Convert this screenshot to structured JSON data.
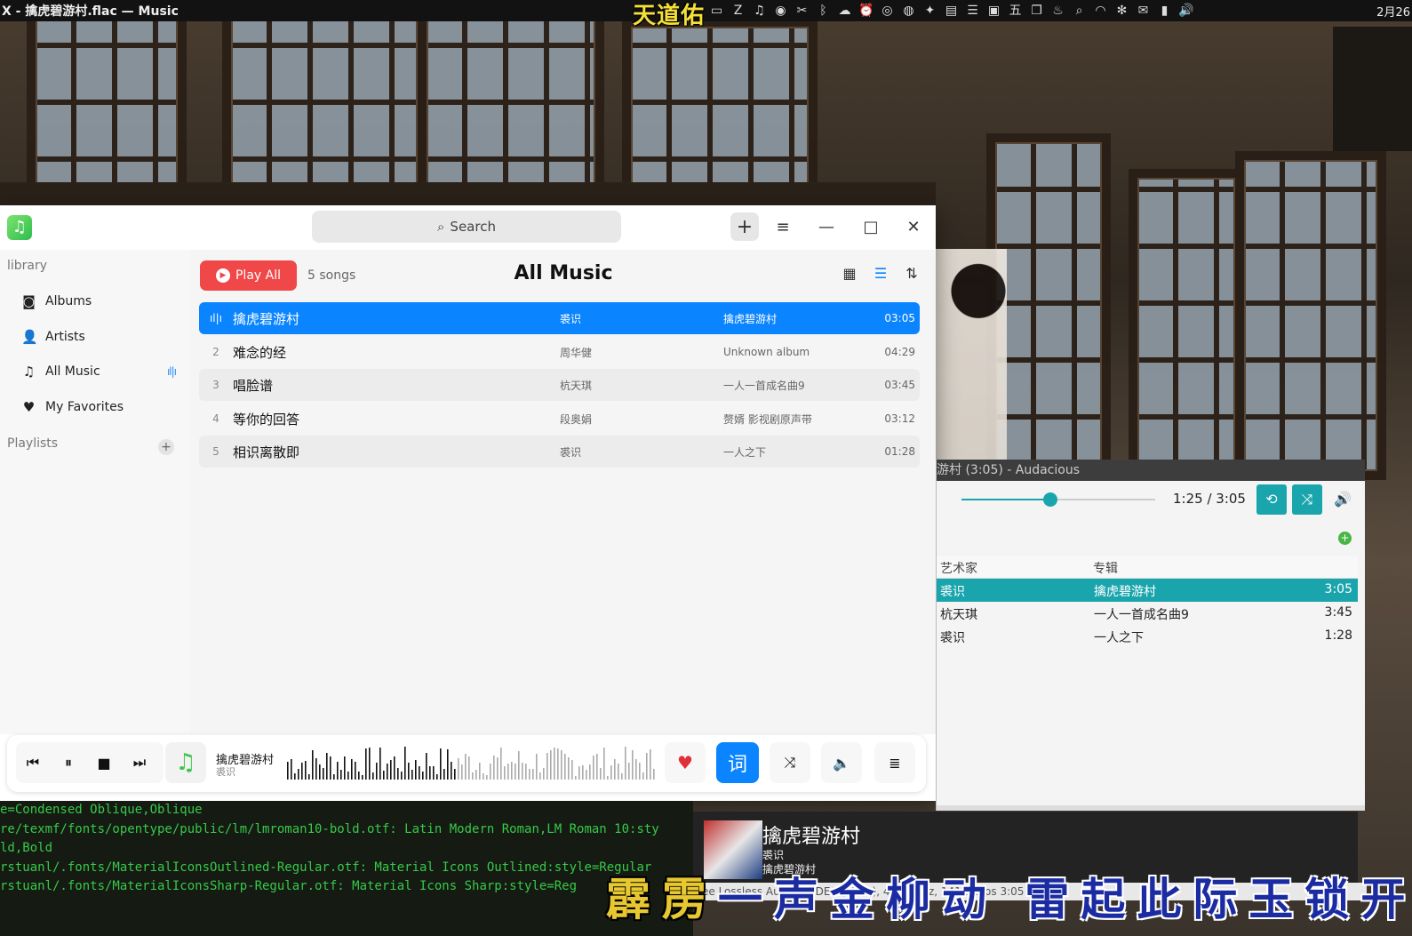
{
  "topbar": {
    "window_title": "X - 擒虎碧游村.flac — Music",
    "center_text": "天道佑",
    "tray_icons": [
      "window-icon",
      "zotero-icon",
      "music-note-icon",
      "firefox-icon",
      "scissors-icon",
      "bluetooth-icon",
      "network-icon",
      "alarm-icon",
      "eye-icon",
      "chrome-icon",
      "cluster-icon",
      "clipboard-icon",
      "menu-icon",
      "calendar-icon",
      "input-method-icon",
      "copy-icon",
      "chat-icon",
      "search-icon",
      "wifi-icon",
      "bluetooth2-icon",
      "mail-icon",
      "battery-icon",
      "volume-icon"
    ],
    "tray_glyphs": [
      "▭",
      "Z",
      "♫",
      "◉",
      "✂",
      "ᛒ",
      "☁",
      "⏰",
      "◎",
      "◍",
      "✦",
      "▤",
      "☰",
      "▣",
      "五",
      "❐",
      "♨",
      "⌕",
      "◠",
      "✻",
      "✉",
      "▮",
      "🔊"
    ],
    "clock": "2月26"
  },
  "app": {
    "search_placeholder": "Search",
    "add_label": "+",
    "menu_glyph": "≡",
    "minimize_glyph": "—",
    "maximize_glyph": "□",
    "close_glyph": "✕",
    "sidebar": {
      "library_heading": "library",
      "items": [
        {
          "label": "Albums",
          "glyph": "◙"
        },
        {
          "label": "Artists",
          "glyph": "👤"
        },
        {
          "label": "All Music",
          "glyph": "♫"
        },
        {
          "label": "My Favorites",
          "glyph": "♥"
        }
      ],
      "playlists_heading": "Playlists",
      "playlist_add": "+"
    },
    "main": {
      "play_all_label": "Play All",
      "song_count": "5 songs",
      "title": "All Music",
      "view_grid_glyph": "▦",
      "view_list_glyph": "☰",
      "sort_glyph": "⇅",
      "playing_glyph": "ıl|ı",
      "songs": [
        {
          "no": "1",
          "title": "擒虎碧游村",
          "artist": "裘识",
          "album": "擒虎碧游村",
          "duration": "03:05",
          "selected": true
        },
        {
          "no": "2",
          "title": "难念的经",
          "artist": "周华健",
          "album": "Unknown album",
          "duration": "04:29"
        },
        {
          "no": "3",
          "title": "唱脸谱",
          "artist": "杭天琪",
          "album": "一人一首成名曲9",
          "duration": "03:45"
        },
        {
          "no": "4",
          "title": "等你的回答",
          "artist": "段奥娟",
          "album": "赘婿 影视剧原声带",
          "duration": "03:12"
        },
        {
          "no": "5",
          "title": "相识离散即",
          "artist": "裘识",
          "album": "一人之下",
          "duration": "01:28"
        }
      ]
    },
    "player": {
      "prev_glyph": "⏮",
      "pause_glyph": "⏸",
      "stop_glyph": "■",
      "next_glyph": "⏭",
      "cover_glyph": "♫",
      "now_title": "擒虎碧游村",
      "now_artist": "裘识",
      "progress": 0.46,
      "favorite_glyph": "♥",
      "lyrics_label": "词",
      "shuffle_glyph": "⤨",
      "volume_glyph": "🔈",
      "queue_glyph": "≣"
    }
  },
  "audacious": {
    "title": "游村 (3:05) - Audacious",
    "time": "1:25 / 3:05",
    "position": 0.46,
    "repeat_glyph": "⟲",
    "shuffle_glyph": "⤨",
    "volume_glyph": "🔊",
    "add_glyph": "+",
    "col_artist": "艺术家",
    "col_album": "专辑",
    "rows": [
      {
        "artist": "裘识",
        "album": "擒虎碧游村",
        "length": "3:05",
        "selected": true
      },
      {
        "artist": "杭天琪",
        "album": "一人一首成名曲9",
        "length": "3:45"
      },
      {
        "artist": "裘识",
        "album": "一人之下",
        "length": "1:28"
      }
    ]
  },
  "terminal": {
    "lines": [
      "e=Condensed Oblique,Oblique",
      "re/texmf/fonts/opentype/public/lm/lmroman10-bold.otf: Latin Modern Roman,LM Roman 10:sty",
      "ld,Bold",
      "rstuanl/.fonts/MaterialIconsOutlined-Regular.otf: Material Icons Outlined:style=Regular",
      "rstuanl/.fonts/MaterialIconsSharp-Regular.otf: Material Icons Sharp:style=Reg"
    ]
  },
  "mini_player": {
    "title": "擒虎碧游村",
    "artist": "裘识",
    "album": "擒虎碧游村",
    "status": "ee Lossless Audio CODEC (FLAC), 44100 Hz, 1411 kbps   3:05 / 1:18"
  },
  "desktop_lyrics": {
    "sung": "霹雳",
    "rest": "一声金柳动 雷起此际玉锁开"
  },
  "colors": {
    "accent_blue": "#0a84ff",
    "play_red": "#f04848",
    "aud_teal": "#1aa5ad"
  }
}
